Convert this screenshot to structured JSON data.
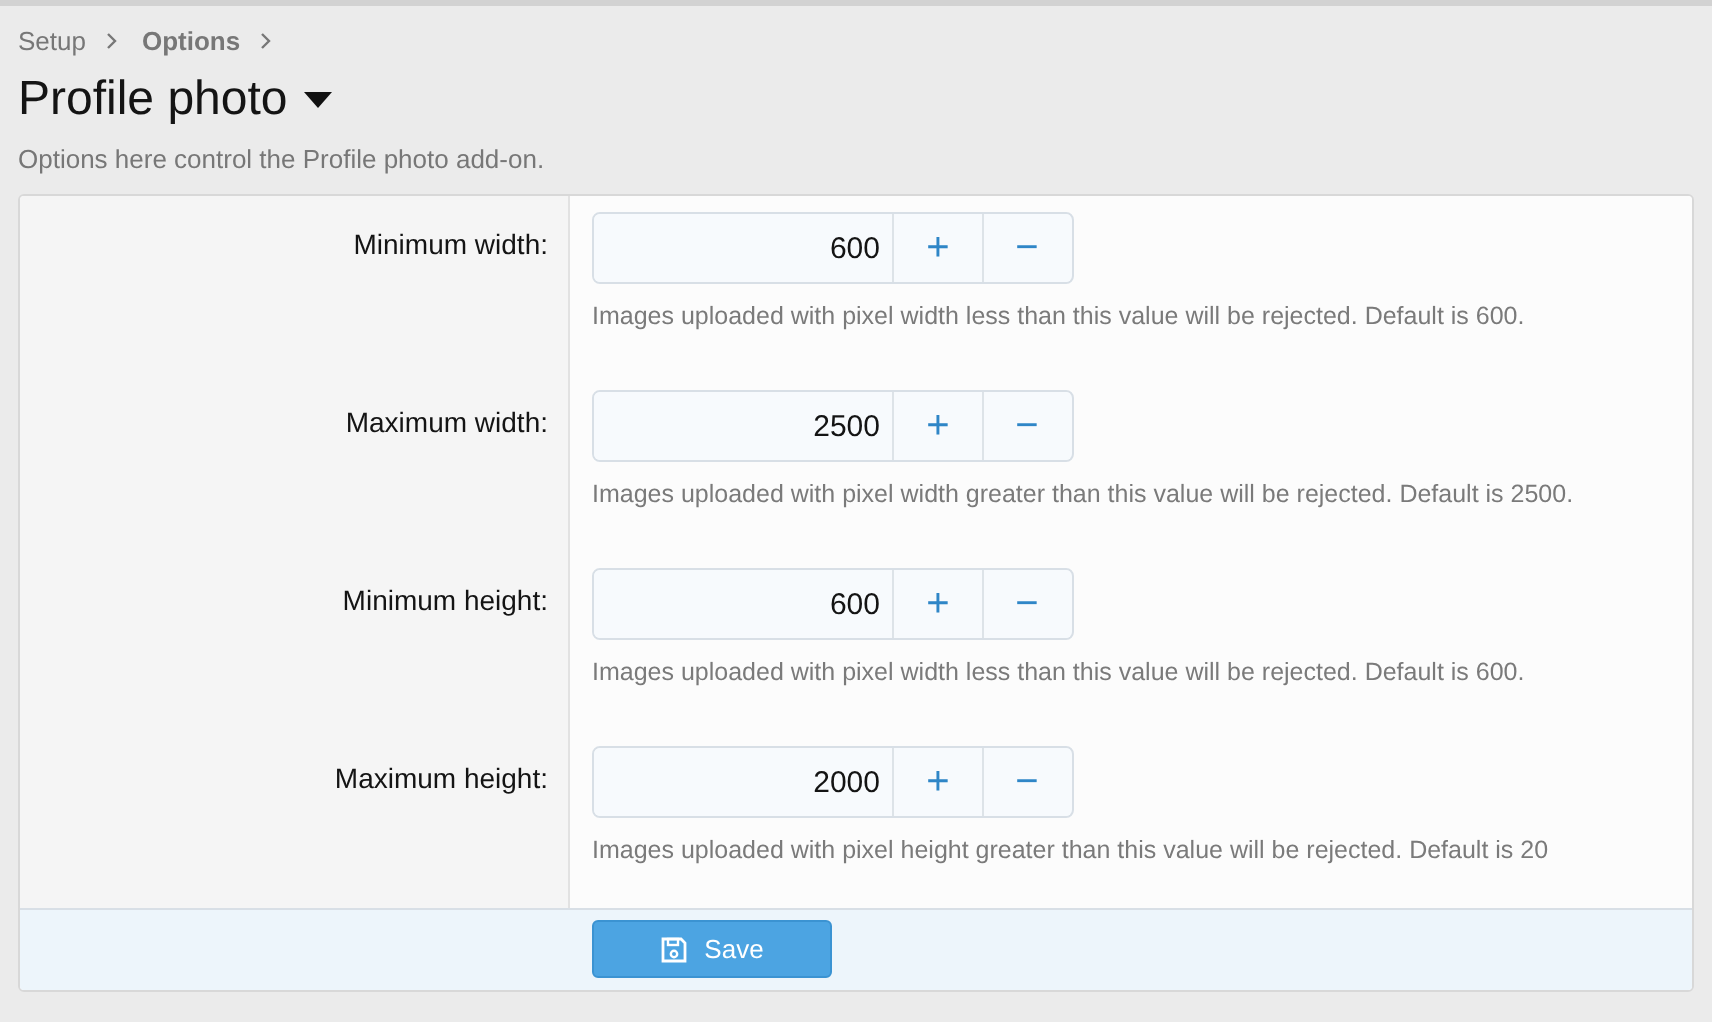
{
  "breadcrumb": [
    "Setup",
    "Options"
  ],
  "title": "Profile photo",
  "description": "Options here control the Profile photo add-on.",
  "options": [
    {
      "label": "Minimum width:",
      "value": "600",
      "increment": "+",
      "decrement": "−",
      "hint": "Images uploaded with pixel width less than this value will be rejected. Default is 600."
    },
    {
      "label": "Maximum width:",
      "value": "2500",
      "increment": "+",
      "decrement": "−",
      "hint": "Images uploaded with pixel width greater than this value will be rejected. Default is 2500."
    },
    {
      "label": "Minimum height:",
      "value": "600",
      "increment": "+",
      "decrement": "−",
      "hint": "Images uploaded with pixel width less than this value will be rejected. Default is 600."
    },
    {
      "label": "Maximum height:",
      "value": "2000",
      "increment": "+",
      "decrement": "−",
      "hint": "Images uploaded with pixel height greater than this value will be rejected. Default is 20"
    }
  ],
  "save_button": "Save"
}
